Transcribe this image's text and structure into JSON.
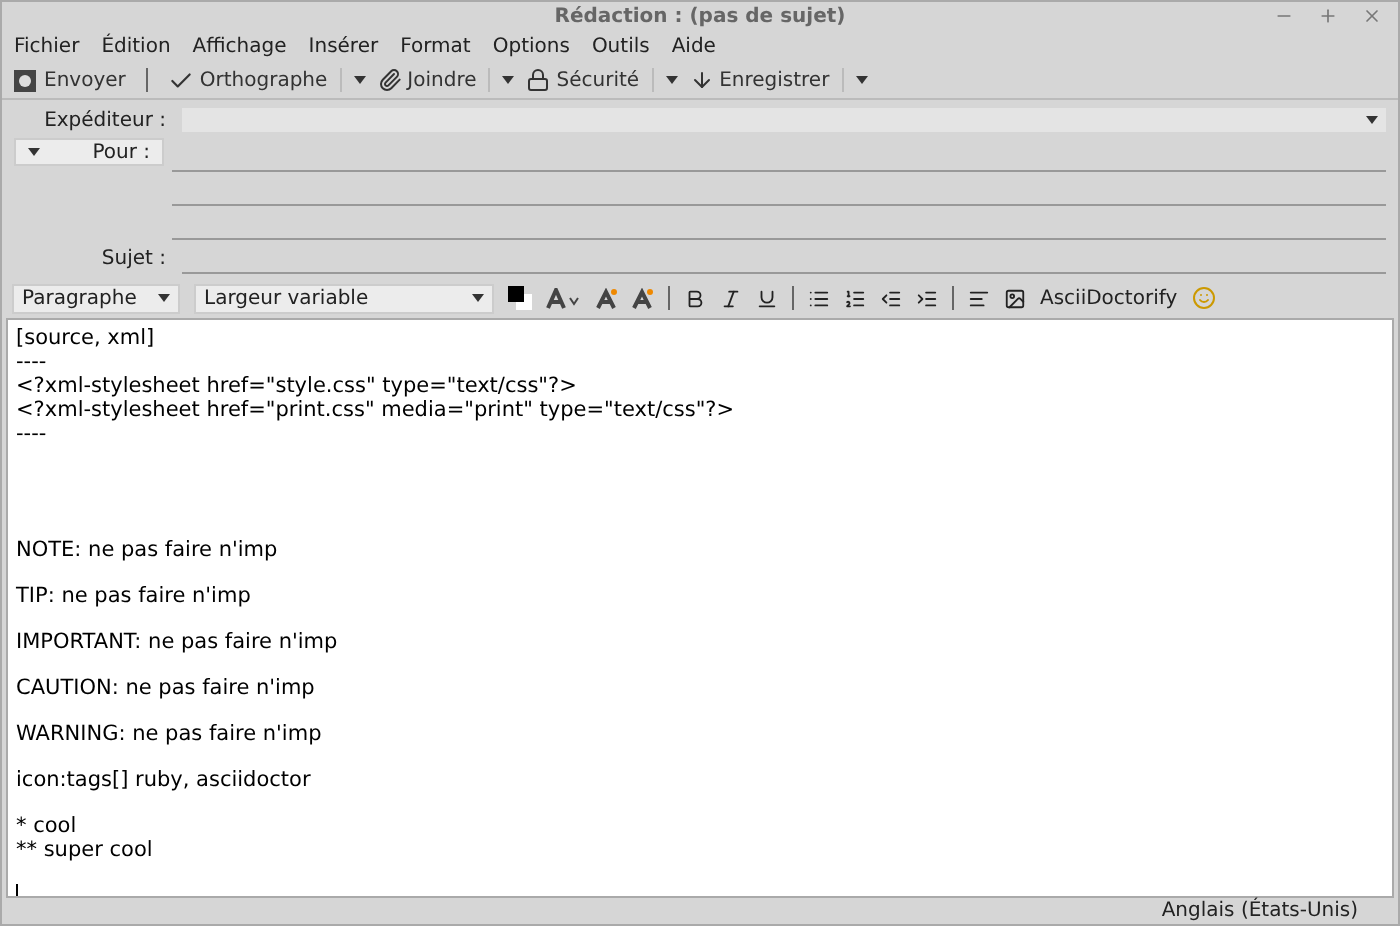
{
  "window": {
    "title": "Rédaction : (pas de sujet)"
  },
  "menu": [
    "Fichier",
    "Édition",
    "Affichage",
    "Insérer",
    "Format",
    "Options",
    "Outils",
    "Aide"
  ],
  "toolbar": [
    {
      "label": "Envoyer",
      "kind": "send"
    },
    {
      "label": "Orthographe",
      "kind": "spell"
    },
    {
      "label": "Joindre",
      "kind": "attach"
    },
    {
      "label": "Sécurité",
      "kind": "security"
    },
    {
      "label": "Enregistrer",
      "kind": "save"
    }
  ],
  "header": {
    "from_label": "Expéditeur :",
    "to_label": "Pour :",
    "subject_label": "Sujet :"
  },
  "format_bar": {
    "paragraph": "Paragraphe",
    "font": "Largeur variable",
    "plugin": "AsciiDoctorify"
  },
  "body": [
    {
      "kind": "listing",
      "lines": [
        "[source, xml]",
        "----",
        "<?xml-stylesheet href=\"style.css\" type=\"text/css\"?>",
        "<?xml-stylesheet href=\"print.css\" media=\"print\" type=\"text/css\"?>",
        "----"
      ]
    },
    {
      "kind": "para",
      "lines": [
        "NOTE: ne pas faire n'imp"
      ]
    },
    {
      "kind": "para",
      "lines": [
        "TIP: ne pas faire n'imp"
      ]
    },
    {
      "kind": "para",
      "lines": [
        "IMPORTANT: ne pas faire n'imp"
      ]
    },
    {
      "kind": "para",
      "lines": [
        "CAUTION: ne pas faire n'imp"
      ]
    },
    {
      "kind": "para",
      "lines": [
        "WARNING: ne pas faire n'imp"
      ]
    },
    {
      "kind": "para",
      "lines": [
        "icon:tags[] ruby, asciidoctor"
      ]
    },
    {
      "kind": "para",
      "lines": [
        "* cool",
        "** super cool"
      ]
    }
  ],
  "status_bar": {
    "language": "Anglais (États-Unis)"
  }
}
